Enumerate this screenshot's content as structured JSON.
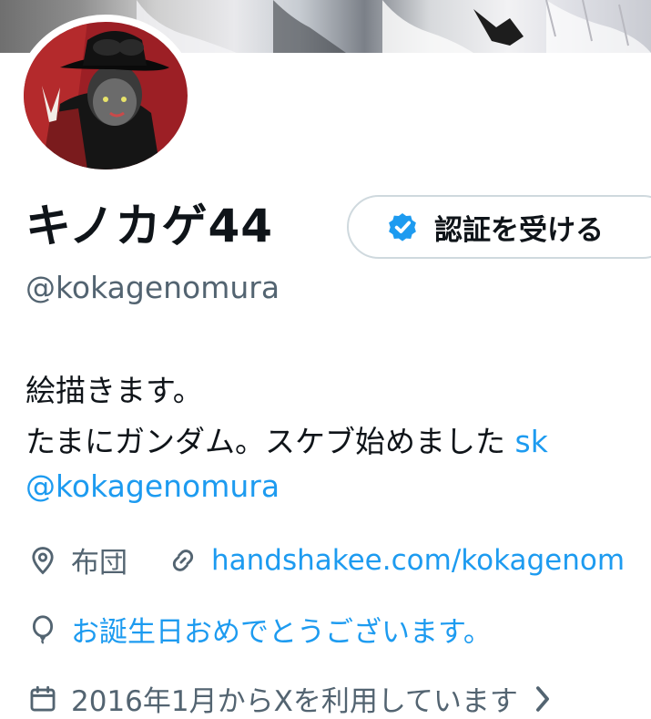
{
  "profile": {
    "display_name": "キノカゲ44",
    "handle": "@kokagenomura",
    "verify_button_label": "認証を受ける"
  },
  "bio": {
    "line1": "絵描きます。",
    "line2_text": "たまにガンダム。スケブ始めました ",
    "line2_link": "sk",
    "line3_mention": "@kokagenomura"
  },
  "meta": {
    "location": "布団",
    "website": "handshakee.com/kokagenom",
    "birthday": "お誕生日おめでとうございます。",
    "joined": "2016年1月からXを利用しています"
  },
  "icons": {
    "verify": "verified-badge-icon",
    "location": "location-pin-icon",
    "website": "link-icon",
    "birthday": "balloon-icon",
    "joined": "calendar-icon",
    "chevron": "chevron-right-icon"
  },
  "colors": {
    "link": "#1d9bf0",
    "secondary_text": "#536471",
    "primary_text": "#0f1419",
    "border": "#cfd9de"
  }
}
